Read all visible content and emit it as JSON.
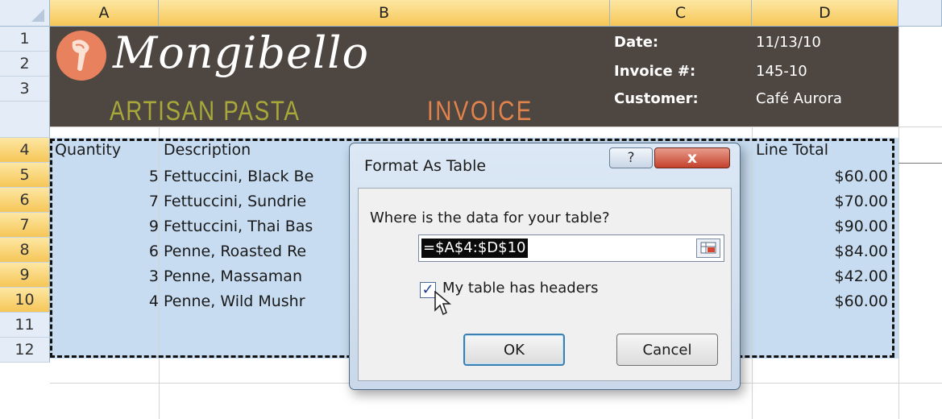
{
  "columns": [
    "A",
    "B",
    "C",
    "D"
  ],
  "rows": [
    "1",
    "2",
    "3",
    "4",
    "5",
    "6",
    "7",
    "8",
    "9",
    "10",
    "11",
    "12"
  ],
  "brand": {
    "name": "Mongibello",
    "tagline": "ARTISAN PASTA",
    "doc_title": "INVOICE"
  },
  "meta": [
    {
      "label": "Date:",
      "value": "11/13/10"
    },
    {
      "label": "Invoice #:",
      "value": "145-10"
    },
    {
      "label": "Customer:",
      "value": "Café Aurora"
    }
  ],
  "table": {
    "headers": {
      "quantity": "Quantity",
      "description": "Description",
      "line_total": "Line Total"
    },
    "rows": [
      {
        "qty": "5",
        "desc": "Fettuccini, Black Be",
        "total": "$60.00"
      },
      {
        "qty": "7",
        "desc": "Fettuccini, Sundrie",
        "total": "$70.00"
      },
      {
        "qty": "9",
        "desc": "Fettuccini, Thai Bas",
        "total": "$90.00"
      },
      {
        "qty": "6",
        "desc": "Penne, Roasted Re",
        "total": "$84.00"
      },
      {
        "qty": "3",
        "desc": "Penne, Massaman",
        "total": "$42.00"
      },
      {
        "qty": "4",
        "desc": "Penne, Wild Mushr",
        "total": "$60.00"
      }
    ]
  },
  "dialog": {
    "title": "Format As Table",
    "help": "?",
    "close": "x",
    "question": "Where is the data for your table?",
    "range": "=$A$4:$D$10",
    "has_headers_label": "My table has headers",
    "has_headers_checked": true,
    "ok_label": "OK",
    "cancel_label": "Cancel"
  },
  "colors": {
    "banner": "#4e4641",
    "accent_orange": "#e2834c",
    "accent_olive": "#a8a83a",
    "table_fill": "#c7dcf0",
    "header_highlight": "#f6c657"
  }
}
